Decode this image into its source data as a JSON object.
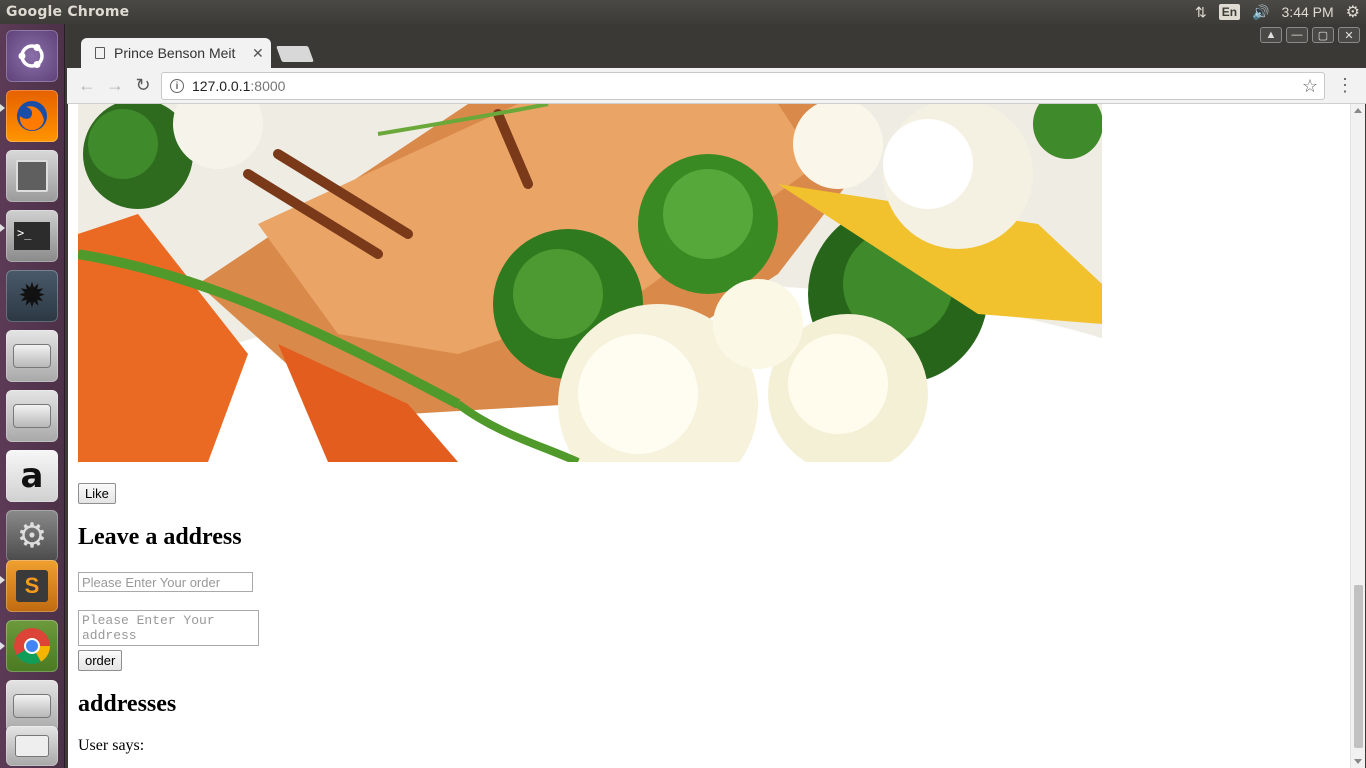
{
  "top_panel": {
    "app_name": "Google Chrome",
    "lang": "En",
    "clock": "3:44 PM"
  },
  "launcher": {
    "items": [
      "ubuntu-dash",
      "firefox",
      "file-manager",
      "terminal",
      "settings-gear",
      "disk-drive",
      "disk-drive",
      "amazon",
      "system-settings",
      "sublime-text",
      "chrome",
      "disk-drive",
      "trash"
    ]
  },
  "browser": {
    "tab_title": "Prince Benson Meit",
    "url_host": "127.0.0.1",
    "url_port": ":8000"
  },
  "page": {
    "like_label": "Like",
    "form_heading": "Leave a address",
    "order_placeholder": "Please Enter Your order",
    "address_placeholder": "Please Enter Your address",
    "order_label": "order",
    "list_heading": "addresses",
    "user_says": "User says:"
  }
}
